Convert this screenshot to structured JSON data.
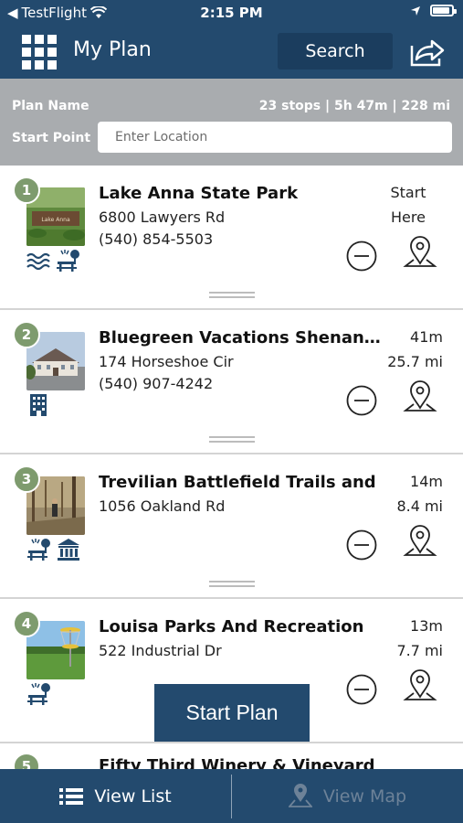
{
  "status_bar": {
    "carrier": "TestFlight",
    "time": "2:15 PM"
  },
  "nav": {
    "title": "My Plan",
    "search_label": "Search",
    "menu_icon": "grid-menu-icon",
    "share_icon": "share-icon"
  },
  "plan": {
    "name_label": "Plan Name",
    "stats": "23 stops | 5h 47m | 228 mi",
    "start_label": "Start Point",
    "start_placeholder": "Enter Location"
  },
  "stops": [
    {
      "number": "1",
      "name": "Lake Anna State Park",
      "address": "6800 Lawyers Rd",
      "phone": "(540) 854-5503",
      "time": "Start",
      "distance": "Here",
      "amenities": [
        "water-icon",
        "picnic-icon"
      ]
    },
    {
      "number": "2",
      "name": "Bluegreen Vacations Shenandoah",
      "address": "174 Horseshoe Cir",
      "phone": "(540) 907-4242",
      "time": "41m",
      "distance": "25.7 mi",
      "amenities": [
        "lodging-icon"
      ]
    },
    {
      "number": "3",
      "name": "Trevilian Battlefield Trails and",
      "address": "1056 Oakland Rd",
      "phone": "",
      "time": "14m",
      "distance": "8.4 mi",
      "amenities": [
        "picnic-icon",
        "museum-icon"
      ]
    },
    {
      "number": "4",
      "name": "Louisa Parks And Recreation",
      "address": "522 Industrial Dr",
      "phone": "",
      "time": "13m",
      "distance": "7.7 mi",
      "amenities": [
        "picnic-icon"
      ]
    }
  ],
  "stop5": {
    "number": "5",
    "name": "Fifty Third Winery & Vineyard"
  },
  "start_plan_label": "Start Plan",
  "tabs": {
    "list": "View List",
    "map": "View Map"
  },
  "colors": {
    "primary": "#234a6e",
    "badge": "#7e9b6e",
    "plan_bar": "#a9acaf"
  }
}
